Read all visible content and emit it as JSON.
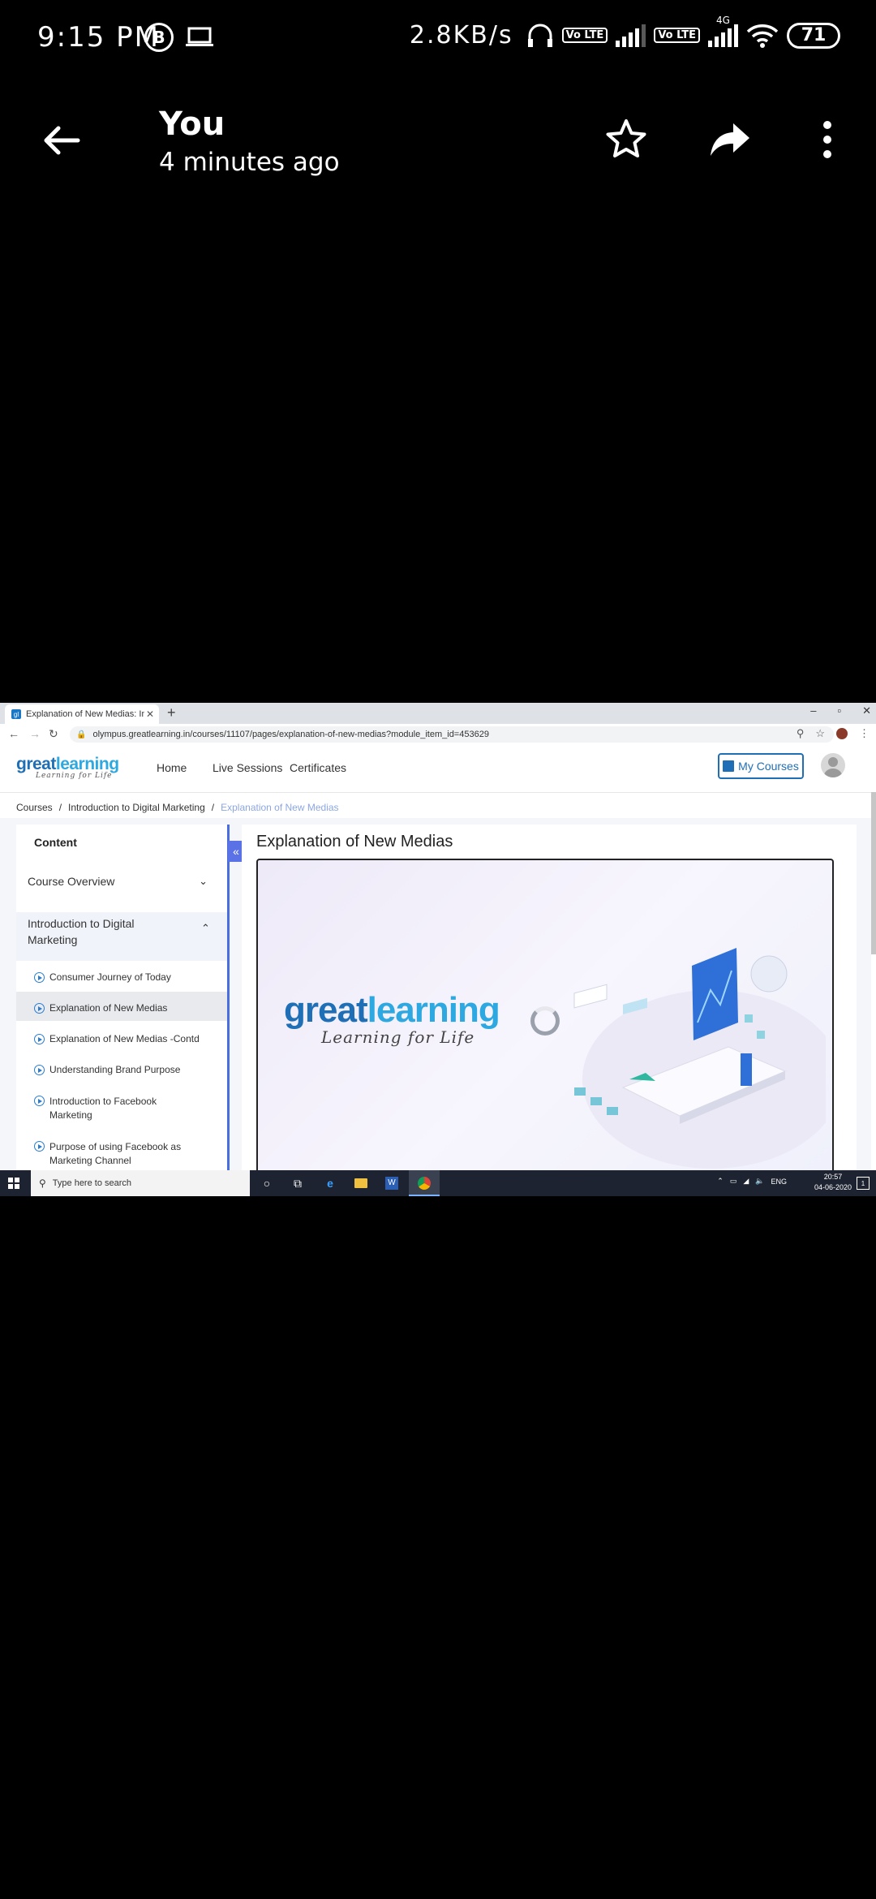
{
  "status_bar": {
    "time": "9:15 PM",
    "speed": "2.8KB/s",
    "volte1": "Vo LTE",
    "volte2": "Vo LTE",
    "net_type": "4G",
    "battery": "71"
  },
  "viewer": {
    "title": "You",
    "subtitle": "4 minutes ago"
  },
  "browser": {
    "tab_title": "Explanation of New Medias: Intro",
    "new_tab": "+",
    "win_minimize": "–",
    "win_restore": "▫",
    "win_close": "✕",
    "url": "olympus.greatlearning.in/courses/11107/pages/explanation-of-new-medias?module_item_id=453629"
  },
  "site": {
    "logo_main_a": "great",
    "logo_main_b": "learning",
    "logo_tagline": "Learning for Life",
    "nav": [
      "Home",
      "Live Sessions",
      "Certificates"
    ],
    "my_courses": "My Courses"
  },
  "breadcrumb": [
    "Courses",
    "/",
    "Introduction to Digital Marketing",
    "/",
    "Explanation of New Medias"
  ],
  "sidebar": {
    "heading": "Content",
    "sections": [
      {
        "label": "Course Overview",
        "chevron": "⌄"
      },
      {
        "label": "Introduction to Digital Marketing",
        "chevron": "⌃"
      }
    ],
    "items": [
      "Consumer Journey of Today",
      "Explanation of New Medias",
      "Explanation of New Medias -Contd",
      "Understanding Brand Purpose",
      "Introduction to Facebook Marketing",
      "Purpose of using Facebook as Marketing Channel"
    ],
    "collapse": "«"
  },
  "content": {
    "title": "Explanation of New Medias",
    "video_logo_a": "great",
    "video_logo_b": "learning",
    "video_tagline": "Learning for Life"
  },
  "taskbar": {
    "search_placeholder": "Type here to search",
    "lang": "ENG",
    "time": "20:57",
    "date": "04-06-2020",
    "notif_count": "1"
  }
}
